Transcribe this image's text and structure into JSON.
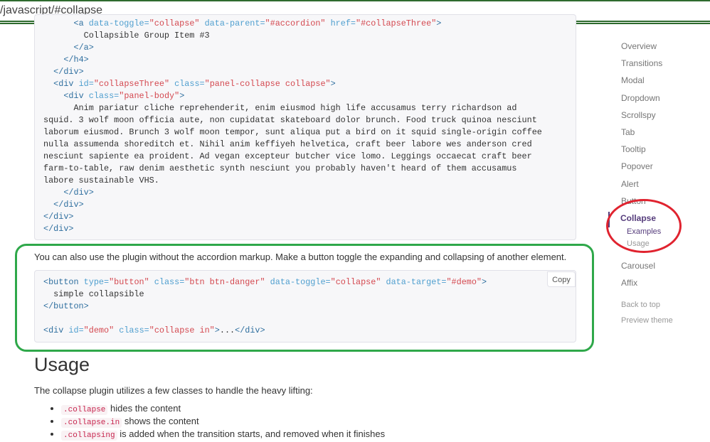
{
  "address_bar": {
    "url": "/javascript/#collapse"
  },
  "top_code": {
    "lines": [
      "      <a data-toggle=\"collapse\" data-parent=\"#accordion\" href=\"#collapseThree\">",
      "        Collapsible Group Item #3",
      "      </a>",
      "    </h4>",
      "  </div>",
      "  <div id=\"collapseThree\" class=\"panel-collapse collapse\">",
      "    <div class=\"panel-body\">",
      "      Anim pariatur cliche reprehenderit, enim eiusmod high life accusamus terry richardson ad",
      "squid. 3 wolf moon officia aute, non cupidatat skateboard dolor brunch. Food truck quinoa nesciunt",
      "laborum eiusmod. Brunch 3 wolf moon tempor, sunt aliqua put a bird on it squid single-origin coffee",
      "nulla assumenda shoreditch et. Nihil anim keffiyeh helvetica, craft beer labore wes anderson cred",
      "nesciunt sapiente ea proident. Ad vegan excepteur butcher vice lomo. Leggings occaecat craft beer",
      "farm-to-table, raw denim aesthetic synth nesciunt you probably haven't heard of them accusamus",
      "labore sustainable VHS.",
      "    </div>",
      "  </div>",
      "</div>",
      "</div>"
    ]
  },
  "example": {
    "description": "You can also use the plugin without the accordion markup. Make a button toggle the expanding and collapsing of another element.",
    "copy_label": "Copy",
    "code_lines": [
      "<button type=\"button\" class=\"btn btn-danger\" data-toggle=\"collapse\" data-target=\"#demo\">",
      "  simple collapsible",
      "</button>",
      "",
      "<div id=\"demo\" class=\"collapse in\">...</div>"
    ]
  },
  "usage": {
    "heading": "Usage",
    "description": "The collapse plugin utilizes a few classes to handle the heavy lifting:",
    "items": [
      {
        "code": ".collapse",
        "text": " hides the content"
      },
      {
        "code": ".collapse.in",
        "text": " shows the content"
      },
      {
        "code": ".collapsing",
        "text": " is added when the transition starts, and removed when it finishes"
      }
    ]
  },
  "sidebar": {
    "items": [
      "Overview",
      "Transitions",
      "Modal",
      "Dropdown",
      "Scrollspy",
      "Tab",
      "Tooltip",
      "Popover",
      "Alert",
      "Button",
      "Collapse",
      "Carousel",
      "Affix"
    ],
    "active": "Collapse",
    "subitems": [
      "Examples",
      "Usage"
    ],
    "footer_links": [
      "Back to top",
      "Preview theme"
    ]
  },
  "colors": {
    "annotation_green": "#2fa84a",
    "annotation_red": "#e0232f",
    "nav_active": "#563d7c"
  }
}
